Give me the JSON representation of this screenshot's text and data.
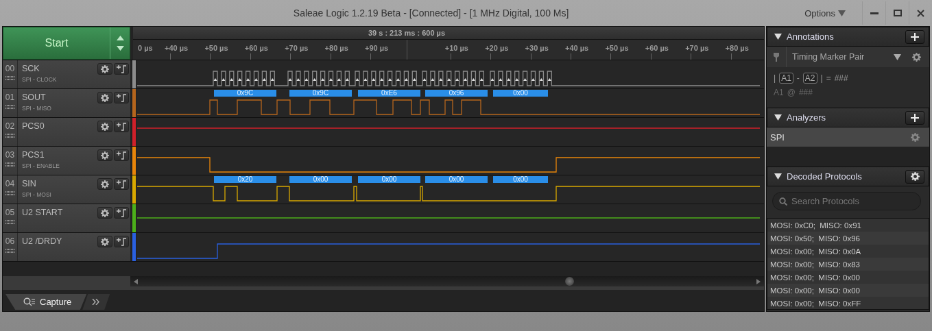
{
  "window": {
    "title": "Saleae Logic 1.2.19 Beta - [Connected] - [1 MHz Digital, 100 Ms]",
    "options": "Options"
  },
  "start_button": "Start",
  "timeline": {
    "marker": "39 s : 213 ms : 600 µs",
    "ticks": [
      "0 µs",
      "+40 µs",
      "+50 µs",
      "+60 µs",
      "+70 µs",
      "+80 µs",
      "+90 µs",
      "+10 µs",
      "+20 µs",
      "+30 µs",
      "+40 µs",
      "+50 µs",
      "+60 µs",
      "+70 µs",
      "+80 µs"
    ]
  },
  "channels": [
    {
      "number": "00",
      "name": "SCK",
      "subtitle": "SPI - CLOCK",
      "color": "#8c8c8c"
    },
    {
      "number": "01",
      "name": "SOUT",
      "subtitle": "SPI - MISO",
      "color": "#b5651d",
      "decoded": [
        "0x9C",
        "0x9C",
        "0xE6",
        "0x96",
        "0x00"
      ]
    },
    {
      "number": "02",
      "name": "PCS0",
      "color": "#d0202a"
    },
    {
      "number": "03",
      "name": "PCS1",
      "subtitle": "SPI - ENABLE",
      "color": "#e8850a"
    },
    {
      "number": "04",
      "name": "SIN",
      "subtitle": "SPI - MOSI",
      "color": "#d8a800",
      "decoded": [
        "0x20",
        "0x00",
        "0x00",
        "0x00",
        "0x00"
      ]
    },
    {
      "number": "05",
      "name": "U2 START",
      "color": "#4caf1a"
    },
    {
      "number": "06",
      "name": "U2 /DRDY",
      "color": "#2a60e0"
    }
  ],
  "bottom_tabs": [
    {
      "label": "Capture",
      "selected": true
    }
  ],
  "annotations": {
    "title": "Annotations",
    "marker_type": "Timing Marker Pair",
    "lines": [
      {
        "kind": "diff",
        "open": "|",
        "close": "|",
        "a": "A1",
        "b": "A2",
        "sep": "-",
        "eq": "=",
        "value": "###"
      },
      {
        "kind": "at",
        "a": "A1",
        "sep": "@",
        "value": "###"
      }
    ]
  },
  "analyzers": {
    "title": "Analyzers",
    "items": [
      {
        "name": "SPI",
        "selected": true
      }
    ]
  },
  "decoded_protocols": {
    "title": "Decoded Protocols",
    "search": {
      "placeholder": "Search Protocols"
    },
    "rows": [
      "MOSI: 0xC0;  MISO: 0x91",
      "MOSI: 0x50;  MISO: 0x96",
      "MOSI: 0x00;  MISO: 0x0A",
      "MOSI: 0x00;  MISO: 0x83",
      "MOSI: 0x00;  MISO: 0x00",
      "MOSI: 0x00;  MISO: 0x00",
      "MOSI: 0x00;  MISO: 0xFF"
    ]
  }
}
